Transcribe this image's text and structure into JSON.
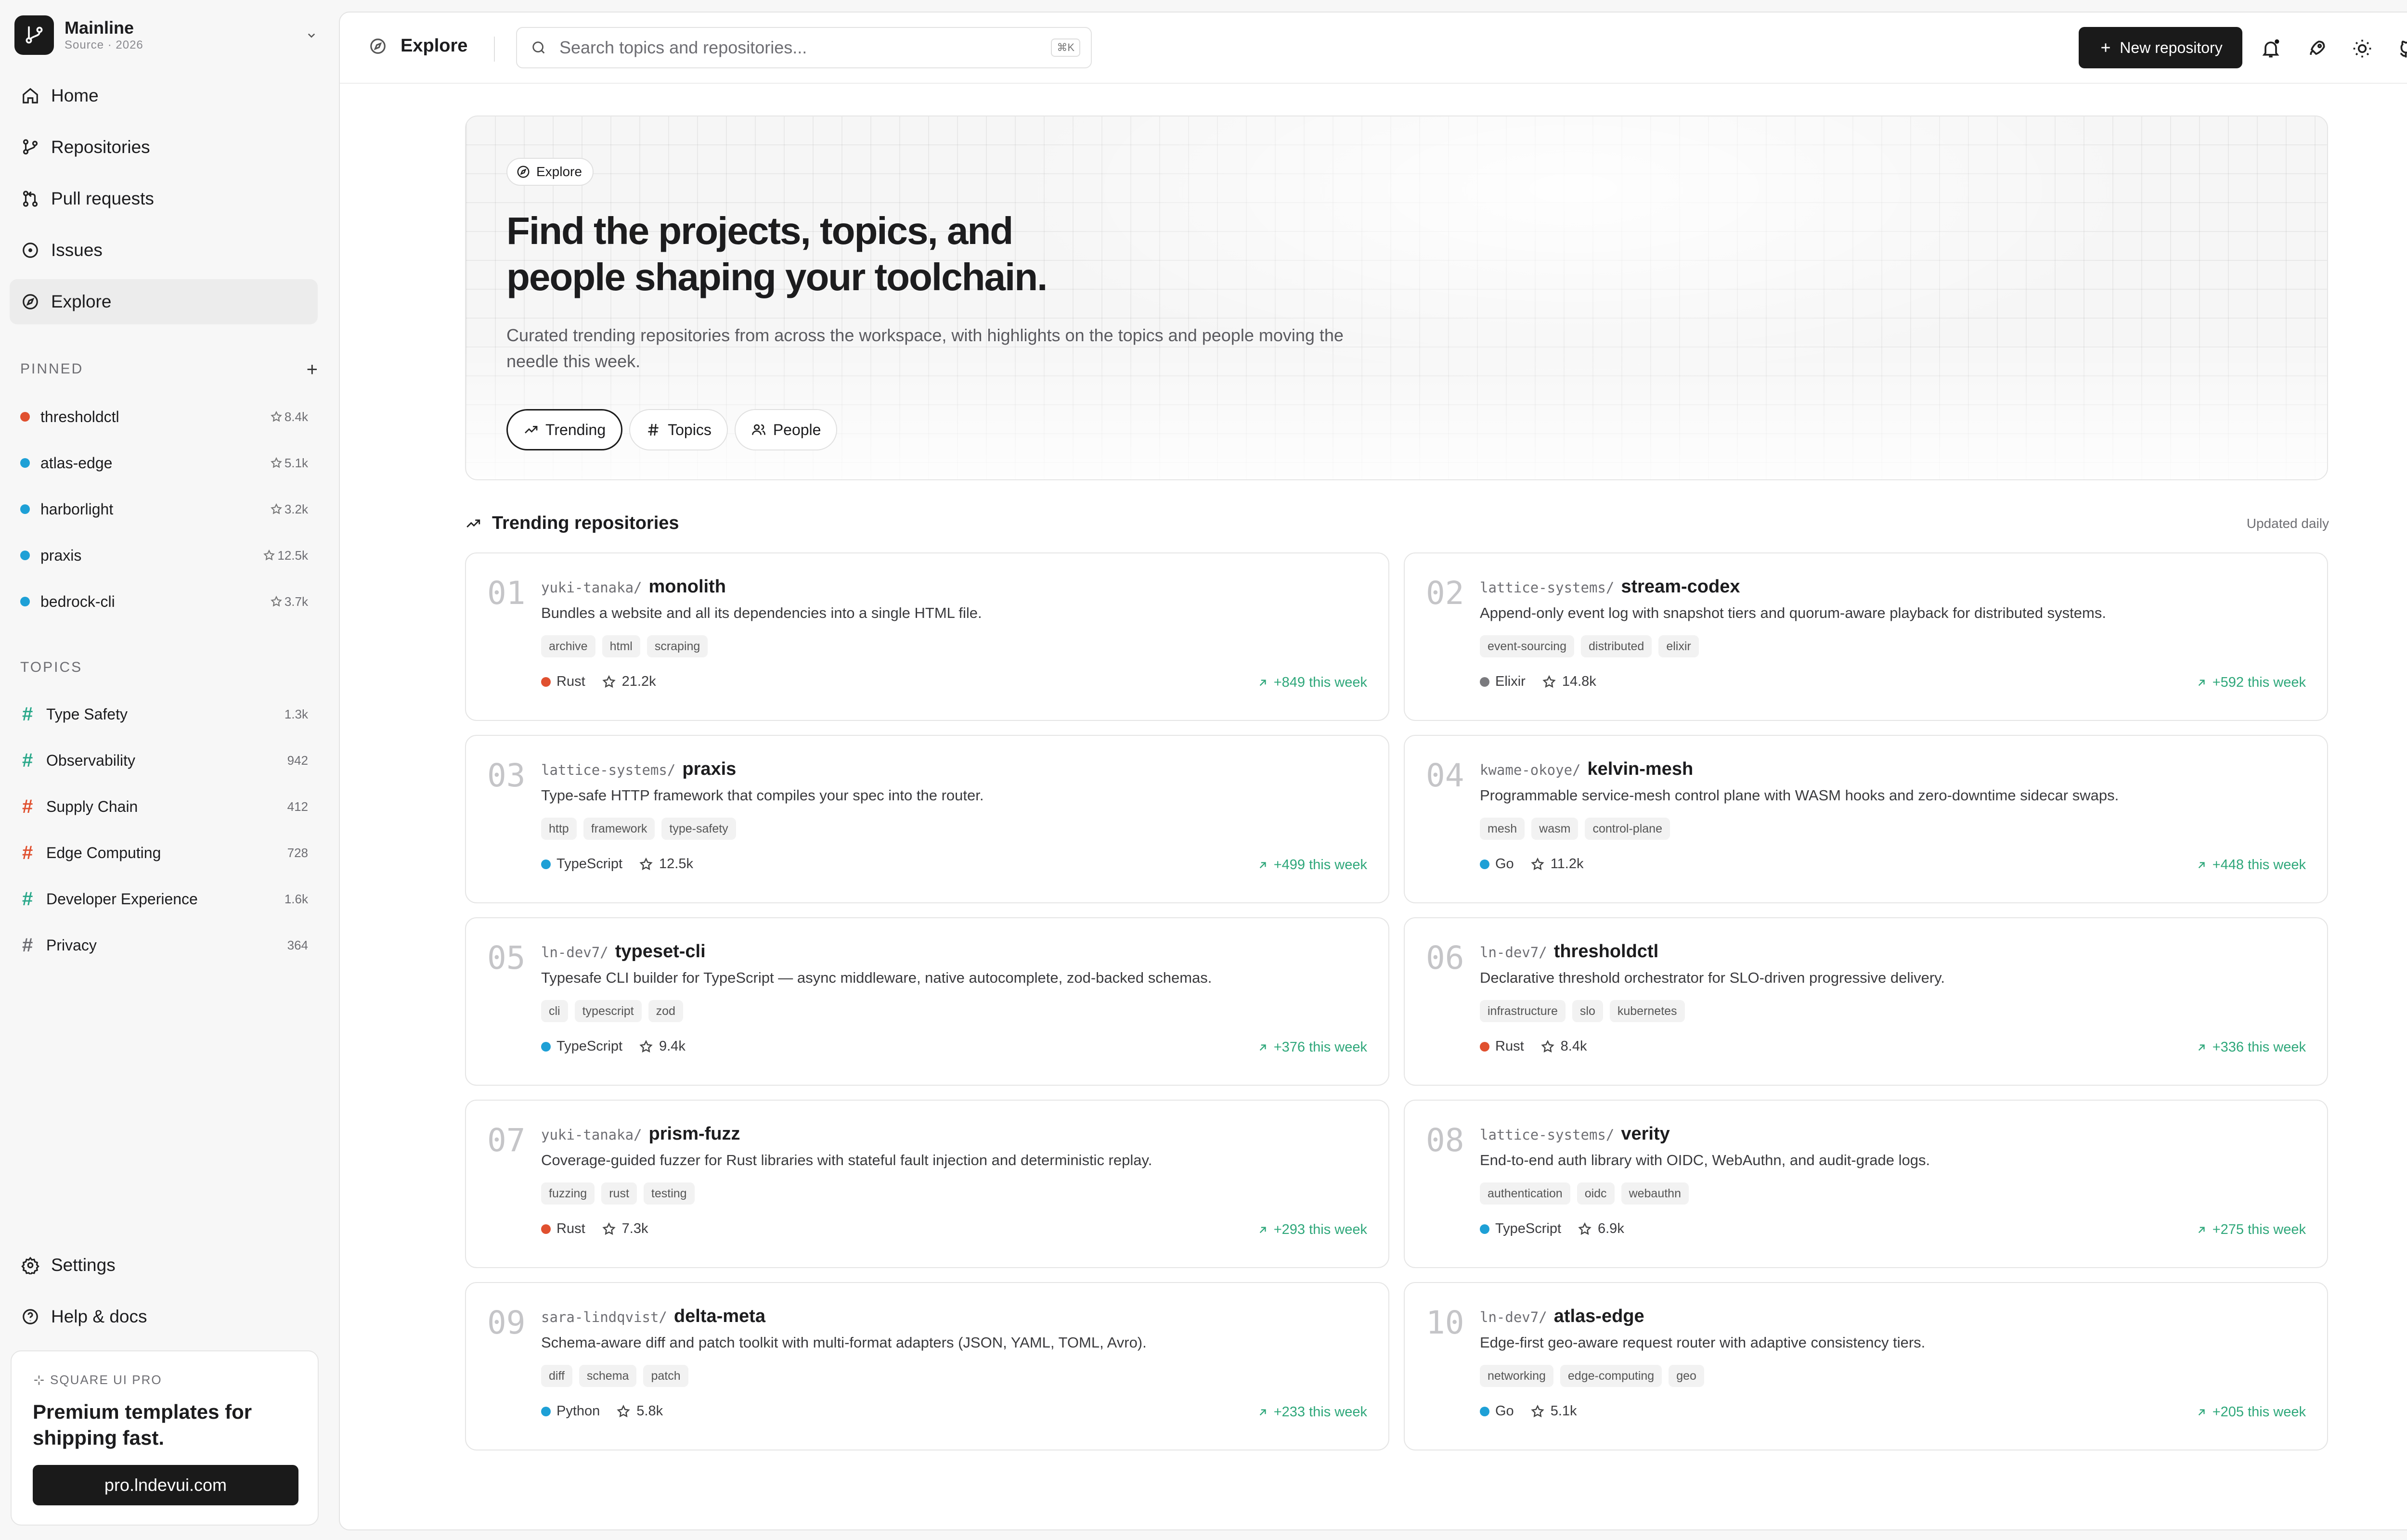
{
  "workspace": {
    "name": "Mainline",
    "subtitle": "Source · 2026"
  },
  "nav": [
    "Home",
    "Repositories",
    "Pull requests",
    "Issues",
    "Explore"
  ],
  "pinned": {
    "heading": "PINNED",
    "items": [
      {
        "name": "thresholdctl",
        "stars": "8.4k",
        "color": "#e0502f"
      },
      {
        "name": "atlas-edge",
        "stars": "5.1k",
        "color": "#1ea0d6"
      },
      {
        "name": "harborlight",
        "stars": "3.2k",
        "color": "#1ea0d6"
      },
      {
        "name": "praxis",
        "stars": "12.5k",
        "color": "#1ea0d6"
      },
      {
        "name": "bedrock-cli",
        "stars": "3.7k",
        "color": "#1ea0d6"
      }
    ]
  },
  "topics": {
    "heading": "TOPICS",
    "items": [
      {
        "name": "Type Safety",
        "count": "1.3k",
        "color": "#2aa88a"
      },
      {
        "name": "Observability",
        "count": "942",
        "color": "#2aa88a"
      },
      {
        "name": "Supply Chain",
        "count": "412",
        "color": "#e0502f"
      },
      {
        "name": "Edge Computing",
        "count": "728",
        "color": "#e0502f"
      },
      {
        "name": "Developer Experience",
        "count": "1.6k",
        "color": "#2aa88a"
      },
      {
        "name": "Privacy",
        "count": "364",
        "color": "#6e6e73"
      }
    ]
  },
  "footer_nav": [
    "Settings",
    "Help & docs"
  ],
  "promo": {
    "kicker": "SQUARE UI PRO",
    "title": "Premium templates for shipping fast.",
    "button": "pro.lndevui.com"
  },
  "topbar": {
    "breadcrumb": "Explore",
    "search_placeholder": "Search topics and repositories...",
    "shortcut": "⌘K",
    "new_repo": "New repository"
  },
  "hero": {
    "badge": "Explore",
    "title_line1": "Find the projects, topics, and",
    "title_line2": "people shaping your toolchain.",
    "description": "Curated trending repositories from across the workspace, with highlights on the topics and people moving the needle this week.",
    "tabs": [
      "Trending",
      "Topics",
      "People"
    ]
  },
  "trending": {
    "heading": "Trending repositories",
    "updated": "Updated daily",
    "repos": [
      {
        "rank": "01",
        "owner": "yuki-tanaka/",
        "name": "monolith",
        "description": "Bundles a website and all its dependencies into a single HTML file.",
        "tags": [
          "archive",
          "html",
          "scraping"
        ],
        "language": "Rust",
        "lang_color": "#e0502f",
        "stars": "21.2k",
        "gain": "+849 this week"
      },
      {
        "rank": "02",
        "owner": "lattice-systems/",
        "name": "stream-codex",
        "description": "Append-only event log with snapshot tiers and quorum-aware playback for distributed systems.",
        "tags": [
          "event-sourcing",
          "distributed",
          "elixir"
        ],
        "language": "Elixir",
        "lang_color": "#7a7a7e",
        "stars": "14.8k",
        "gain": "+592 this week"
      },
      {
        "rank": "03",
        "owner": "lattice-systems/",
        "name": "praxis",
        "description": "Type-safe HTTP framework that compiles your spec into the router.",
        "tags": [
          "http",
          "framework",
          "type-safety"
        ],
        "language": "TypeScript",
        "lang_color": "#1ea0d6",
        "stars": "12.5k",
        "gain": "+499 this week"
      },
      {
        "rank": "04",
        "owner": "kwame-okoye/",
        "name": "kelvin-mesh",
        "description": "Programmable service-mesh control plane with WASM hooks and zero-downtime sidecar swaps.",
        "tags": [
          "mesh",
          "wasm",
          "control-plane"
        ],
        "language": "Go",
        "lang_color": "#1ea0d6",
        "stars": "11.2k",
        "gain": "+448 this week"
      },
      {
        "rank": "05",
        "owner": "ln-dev7/",
        "name": "typeset-cli",
        "description": "Typesafe CLI builder for TypeScript — async middleware, native autocomplete, zod-backed schemas.",
        "tags": [
          "cli",
          "typescript",
          "zod"
        ],
        "language": "TypeScript",
        "lang_color": "#1ea0d6",
        "stars": "9.4k",
        "gain": "+376 this week"
      },
      {
        "rank": "06",
        "owner": "ln-dev7/",
        "name": "thresholdctl",
        "description": "Declarative threshold orchestrator for SLO-driven progressive delivery.",
        "tags": [
          "infrastructure",
          "slo",
          "kubernetes"
        ],
        "language": "Rust",
        "lang_color": "#e0502f",
        "stars": "8.4k",
        "gain": "+336 this week"
      },
      {
        "rank": "07",
        "owner": "yuki-tanaka/",
        "name": "prism-fuzz",
        "description": "Coverage-guided fuzzer for Rust libraries with stateful fault injection and deterministic replay.",
        "tags": [
          "fuzzing",
          "rust",
          "testing"
        ],
        "language": "Rust",
        "lang_color": "#e0502f",
        "stars": "7.3k",
        "gain": "+293 this week"
      },
      {
        "rank": "08",
        "owner": "lattice-systems/",
        "name": "verity",
        "description": "End-to-end auth library with OIDC, WebAuthn, and audit-grade logs.",
        "tags": [
          "authentication",
          "oidc",
          "webauthn"
        ],
        "language": "TypeScript",
        "lang_color": "#1ea0d6",
        "stars": "6.9k",
        "gain": "+275 this week"
      },
      {
        "rank": "09",
        "owner": "sara-lindqvist/",
        "name": "delta-meta",
        "description": "Schema-aware diff and patch toolkit with multi-format adapters (JSON, YAML, TOML, Avro).",
        "tags": [
          "diff",
          "schema",
          "patch"
        ],
        "language": "Python",
        "lang_color": "#1ea0d6",
        "stars": "5.8k",
        "gain": "+233 this week"
      },
      {
        "rank": "10",
        "owner": "ln-dev7/",
        "name": "atlas-edge",
        "description": "Edge-first geo-aware request router with adaptive consistency tiers.",
        "tags": [
          "networking",
          "edge-computing",
          "geo"
        ],
        "language": "Go",
        "lang_color": "#1ea0d6",
        "stars": "5.1k",
        "gain": "+205 this week"
      }
    ]
  }
}
